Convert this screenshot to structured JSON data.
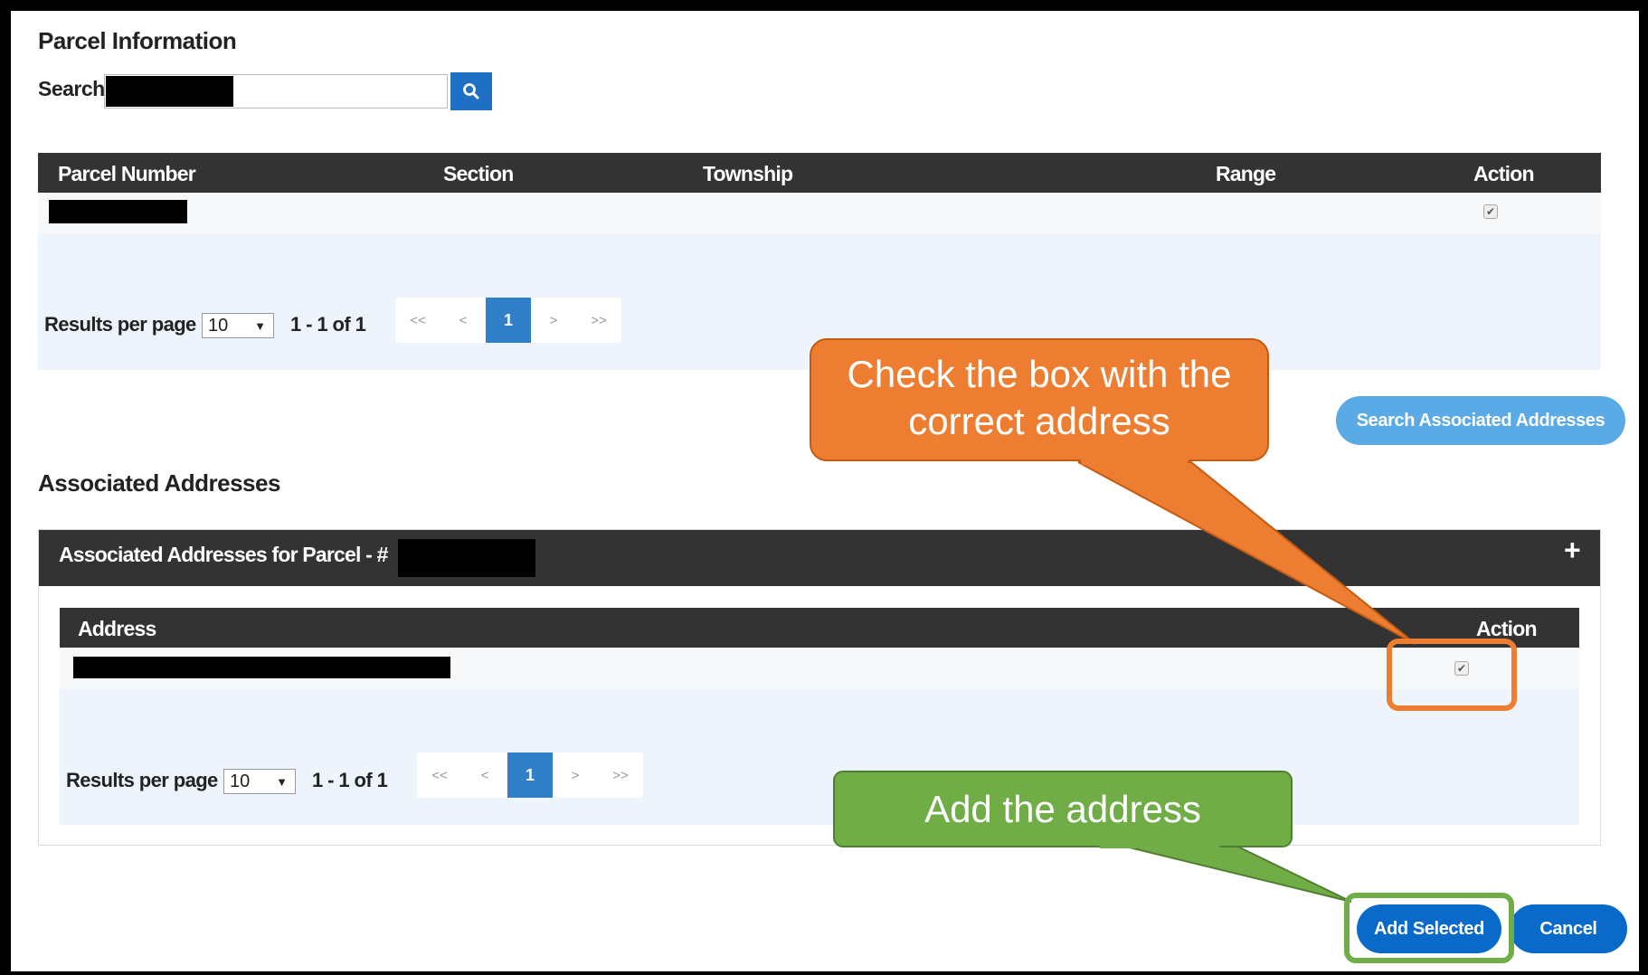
{
  "parcel_section": {
    "title": "Parcel Information",
    "search_label": "Search",
    "search_value": "",
    "table": {
      "headers": [
        "Parcel Number",
        "Section",
        "Township",
        "Range",
        "Action"
      ]
    },
    "pager": {
      "rpp_label": "Results per page",
      "rpp_value": "10",
      "range_text": "1 - 1 of 1",
      "first": "<<",
      "prev": "<",
      "current": "1",
      "next": ">",
      "last": ">>"
    },
    "search_associated_button": "Search Associated Addresses"
  },
  "associated_section": {
    "title": "Associated Addresses",
    "panel_title": "Associated Addresses for Parcel - #",
    "expand_symbol": "+",
    "table": {
      "headers": [
        "Address",
        "Action"
      ]
    },
    "pager": {
      "rpp_label": "Results per page",
      "rpp_value": "10",
      "range_text": "1 - 1 of 1",
      "first": "<<",
      "prev": "<",
      "current": "1",
      "next": ">",
      "last": ">>"
    }
  },
  "footer": {
    "add_selected": "Add Selected",
    "cancel": "Cancel"
  },
  "callouts": {
    "check_box": "Check the box with the correct address",
    "add_address": "Add the address"
  },
  "colors": {
    "header_dark": "#333333",
    "primary_blue": "#0a6ac9",
    "light_blue": "#5aaae6",
    "callout_orange": "#ed7d31",
    "callout_green": "#70ad47"
  }
}
